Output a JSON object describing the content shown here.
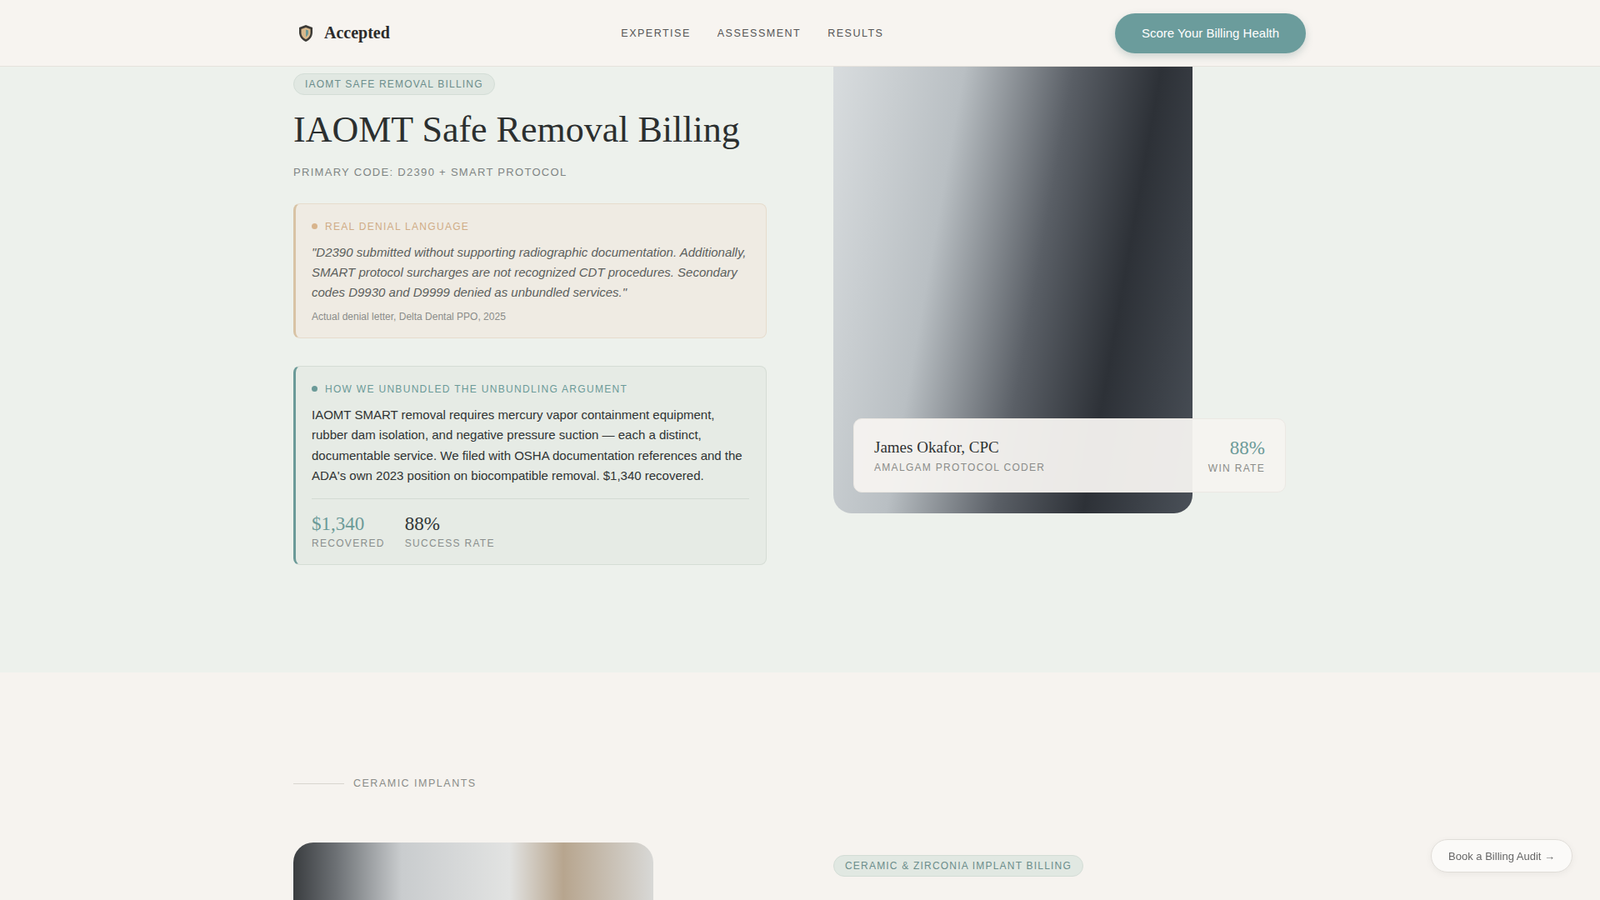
{
  "header": {
    "logo": "Accepted",
    "nav": [
      {
        "label": "EXPERTISE"
      },
      {
        "label": "ASSESSMENT"
      },
      {
        "label": "RESULTS"
      }
    ],
    "cta": "Score Your Billing Health"
  },
  "hero": {
    "badge": "IAOMT SAFE REMOVAL BILLING",
    "title": "IAOMT Safe Removal Billing",
    "code": "PRIMARY CODE: D2390 + SMART PROTOCOL",
    "denial": {
      "label": "REAL DENIAL LANGUAGE",
      "quote": "\"D2390 submitted without supporting radiographic documentation. Additionally, SMART protocol surcharges are not recognized CDT procedures. Secondary codes D9930 and D9999 denied as unbundled services.\"",
      "source": "Actual denial letter, Delta Dental PPO, 2025"
    },
    "solution": {
      "label": "HOW WE UNBUNDLED THE UNBUNDLING ARGUMENT",
      "body": "IAOMT SMART removal requires mercury vapor containment equipment, rubber dam isolation, and negative pressure suction — each a distinct, documentable service. We filed with OSHA documentation references and the ADA's own 2023 position on biocompatible removal. $1,340 recovered.",
      "stats": [
        {
          "value": "$1,340",
          "label": "RECOVERED",
          "color": "#6b9a98"
        },
        {
          "value": "88%",
          "label": "SUCCESS RATE",
          "color": "#2f3636"
        }
      ]
    },
    "coder": {
      "name": "James Okafor, CPC",
      "role": "AMALGAM PROTOCOL CODER",
      "value": "88%",
      "label": "WIN RATE"
    }
  },
  "next_section": {
    "eyebrow": "CERAMIC IMPLANTS",
    "badge": "CERAMIC & ZIRCONIA IMPLANT BILLING"
  },
  "floating_button": "Book a Billing Audit →"
}
